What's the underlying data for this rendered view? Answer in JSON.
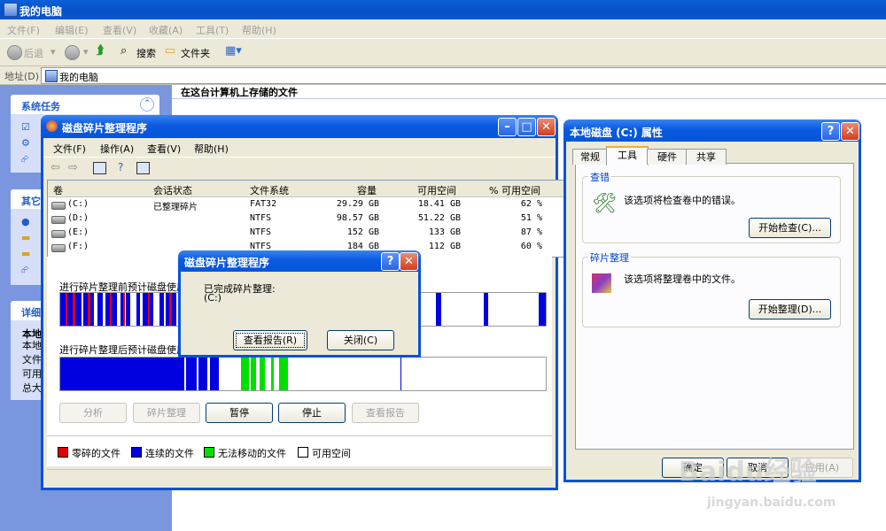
{
  "explorer": {
    "title": "我的电脑",
    "menu": [
      "文件(F)",
      "编辑(E)",
      "查看(V)",
      "收藏(A)",
      "工具(T)",
      "帮助(H)"
    ],
    "toolbar": {
      "back": "后退",
      "search": "搜索",
      "folders": "文件夹"
    },
    "address_label": "地址(D)",
    "address_value": "我的电脑",
    "content_heading": "在这台计算机上存储的文件",
    "taskpane": {
      "system_tasks": "系统任务",
      "other": "其它",
      "details": "详细",
      "details_lines": [
        "本地",
        "本地",
        "文件",
        "可用",
        "总大"
      ]
    }
  },
  "defrag": {
    "title": "磁盘碎片整理程序",
    "menu": [
      "文件(F)",
      "操作(A)",
      "查看(V)",
      "帮助(H)"
    ],
    "columns": [
      "卷",
      "会话状态",
      "文件系统",
      "容量",
      "可用空间",
      "% 可用空间"
    ],
    "rows": [
      {
        "vol": "(C:)",
        "status": "已整理碎片",
        "fs": "FAT32",
        "cap": "29.29 GB",
        "free": "18.41 GB",
        "pct": "62 %"
      },
      {
        "vol": "(D:)",
        "status": "",
        "fs": "NTFS",
        "cap": "98.57 GB",
        "free": "51.22 GB",
        "pct": "51 %"
      },
      {
        "vol": "(E:)",
        "status": "",
        "fs": "NTFS",
        "cap": "152 GB",
        "free": "133 GB",
        "pct": "87 %"
      },
      {
        "vol": "(F:)",
        "status": "",
        "fs": "NTFS",
        "cap": "184 GB",
        "free": "112 GB",
        "pct": "60 %"
      }
    ],
    "before_label": "进行碎片整理前预计磁盘使用",
    "after_label": "进行碎片整理后预计磁盘使用",
    "buttons": {
      "analyze": "分析",
      "defrag": "碎片整理",
      "pause": "暂停",
      "stop": "停止",
      "report": "查看报告"
    },
    "legend": [
      {
        "label": "零碎的文件",
        "color": "#e00000"
      },
      {
        "label": "连续的文件",
        "color": "#0000e0"
      },
      {
        "label": "无法移动的文件",
        "color": "#00e000"
      },
      {
        "label": "可用空间",
        "color": "#ffffff"
      }
    ]
  },
  "dialog": {
    "title": "磁盘碎片整理程序",
    "message_line1": "已完成碎片整理:",
    "message_line2": "(C:)",
    "view_report": "查看报告(R)",
    "close": "关闭(C)"
  },
  "props": {
    "title": "本地磁盘 (C:) 属性",
    "tabs": [
      "常规",
      "工具",
      "硬件",
      "共享"
    ],
    "check_group": "查错",
    "check_text": "该选项将检查卷中的错误。",
    "check_button": "开始检查(C)...",
    "defrag_group": "碎片整理",
    "defrag_text": "该选项将整理卷中的文件。",
    "defrag_button": "开始整理(D)...",
    "ok": "确定",
    "cancel": "取消",
    "apply": "应用(A)"
  },
  "watermark": {
    "brand": "Baidu经验",
    "url": "jingyan.baidu.com"
  },
  "colors": {
    "titlebar": "#0852d8",
    "taskpane": "#7a96df",
    "window_bg": "#ece9d8",
    "accent_tab": "#f8a93a"
  }
}
